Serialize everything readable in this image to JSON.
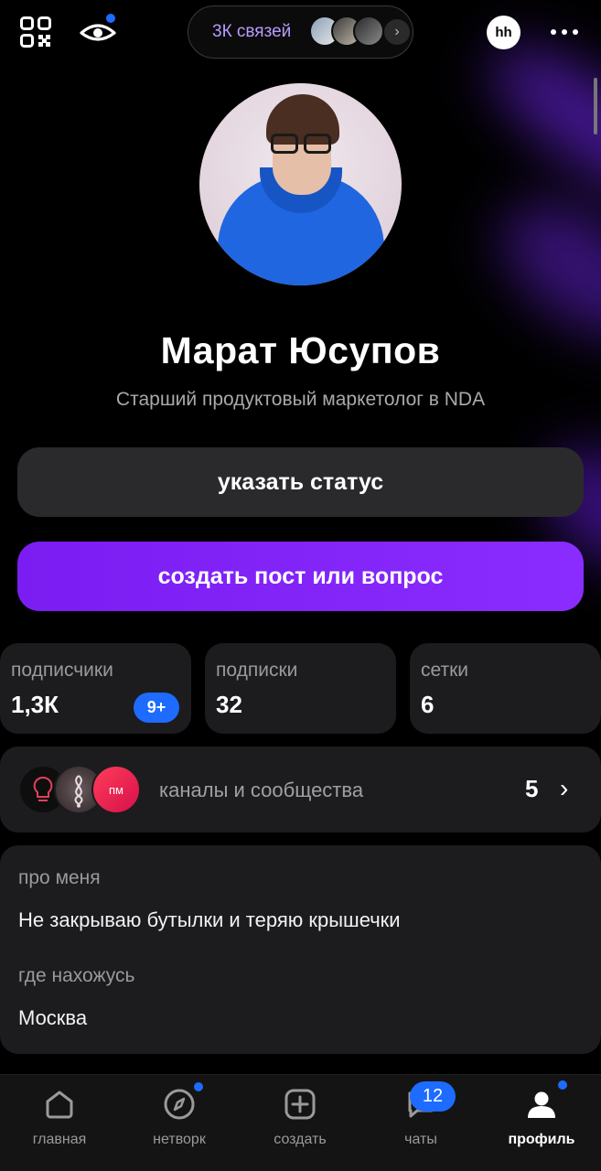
{
  "header": {
    "connections_text": "3К связей",
    "hh_label": "hh"
  },
  "profile": {
    "name": "Марат Юсупов",
    "title": "Старший продуктовый маркетолог в NDA"
  },
  "actions": {
    "status_label": "указать статус",
    "create_label": "создать пост или вопрос"
  },
  "stats": [
    {
      "label": "подписчики",
      "value": "1,3К",
      "badge": "9+"
    },
    {
      "label": "подписки",
      "value": "32"
    },
    {
      "label": "сетки",
      "value": "6"
    }
  ],
  "channels": {
    "label": "каналы и сообщества",
    "count": "5",
    "avatar3_text": "пм"
  },
  "about": {
    "about_heading": "про меня",
    "about_text": "Не закрываю бутылки и теряю крышечки",
    "location_heading": "где нахожусь",
    "location_text": "Москва"
  },
  "nav": {
    "items": [
      {
        "label": "главная",
        "icon": "home-icon"
      },
      {
        "label": "нетворк",
        "icon": "compass-icon"
      },
      {
        "label": "создать",
        "icon": "plus-square-icon"
      },
      {
        "label": "чаты",
        "icon": "chat-icon",
        "badge": "12"
      },
      {
        "label": "профиль",
        "icon": "profile-icon"
      }
    ],
    "active": "профиль"
  },
  "colors": {
    "accent_purple": "#8a2cff",
    "notification_blue": "#1d6bff",
    "card_bg": "#1c1c1e"
  }
}
